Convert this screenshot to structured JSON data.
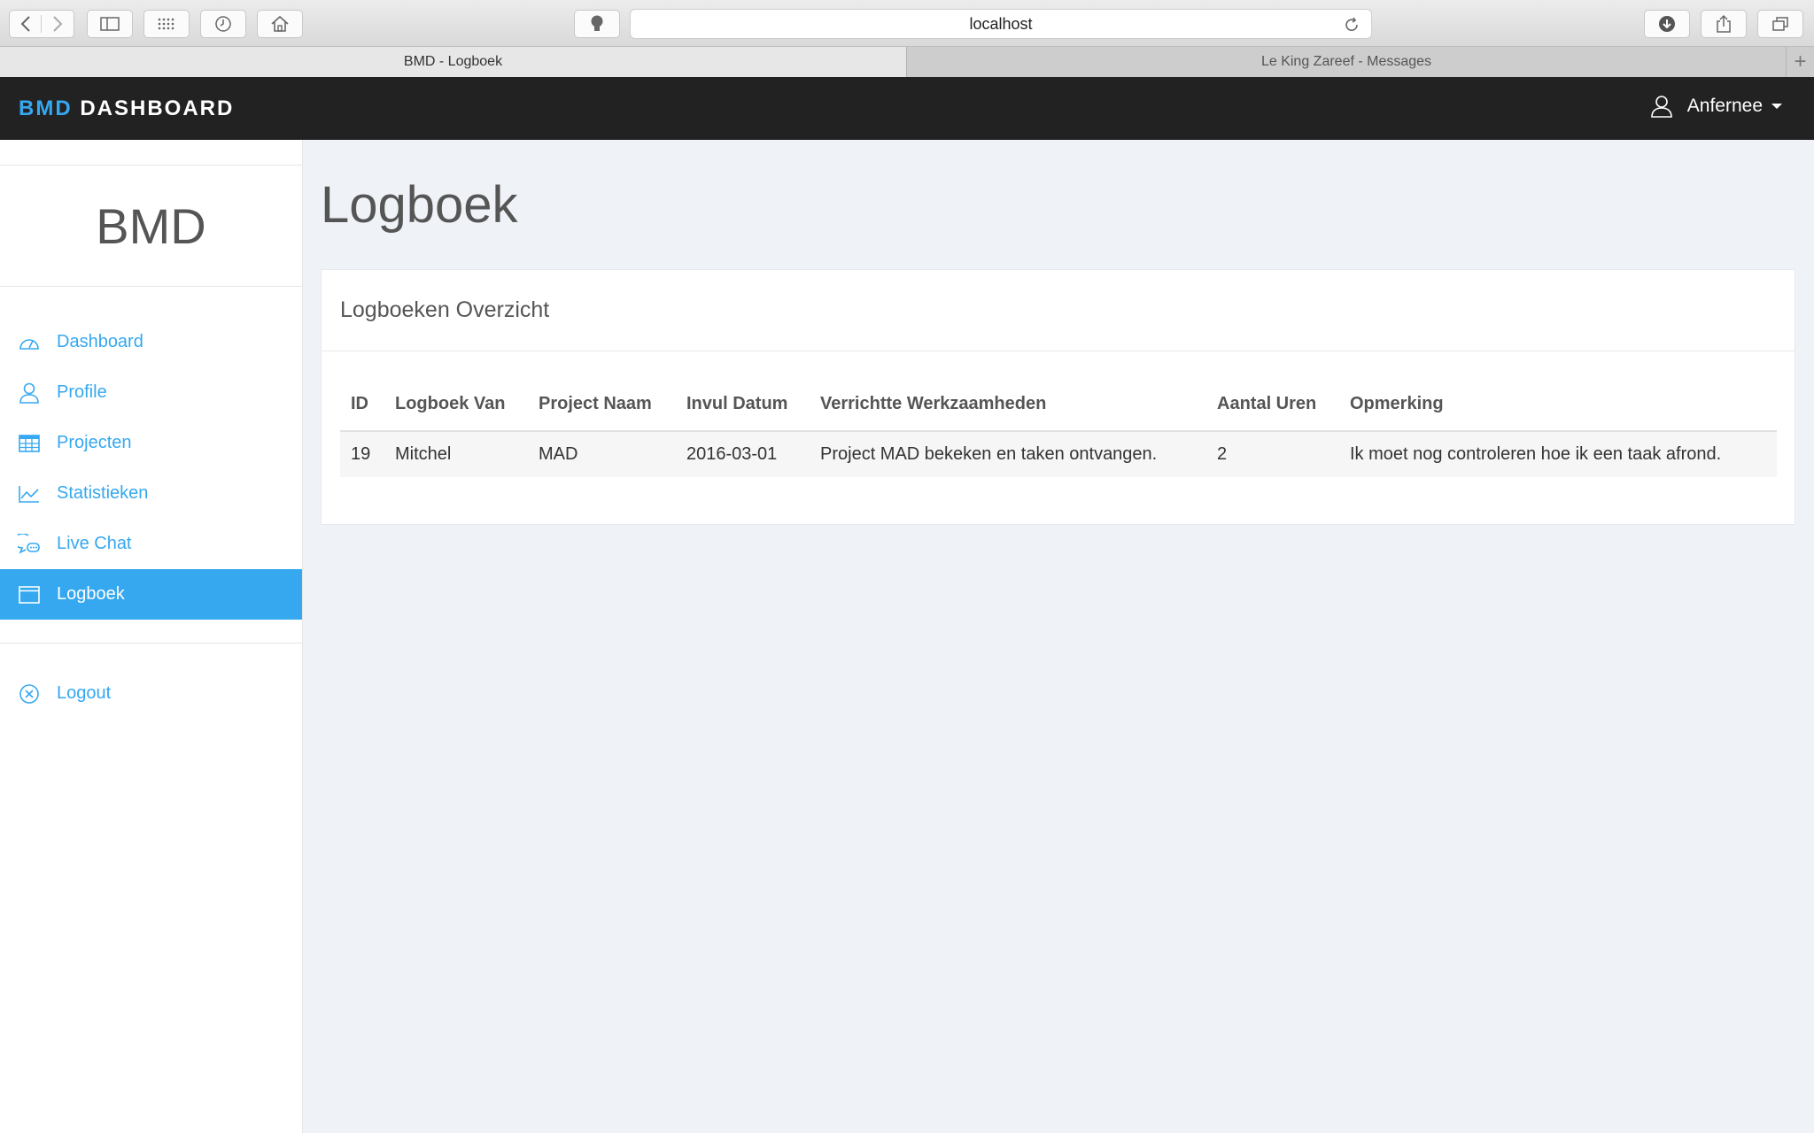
{
  "browser": {
    "url": "localhost",
    "tabs": [
      {
        "label": "BMD - Logboek",
        "active": true
      },
      {
        "label": "Le King Zareef - Messages",
        "active": false
      }
    ],
    "new_tab_label": "+"
  },
  "header": {
    "brand_accent": "BMD",
    "brand_rest": "DASHBOARD",
    "user_name": "Anfernee"
  },
  "sidebar": {
    "logo": "BMD",
    "items": [
      {
        "label": "Dashboard",
        "icon": "dashboard-gauge-icon"
      },
      {
        "label": "Profile",
        "icon": "user-icon"
      },
      {
        "label": "Projecten",
        "icon": "table-grid-icon"
      },
      {
        "label": "Statistieken",
        "icon": "line-chart-icon"
      },
      {
        "label": "Live Chat",
        "icon": "chat-bubbles-icon"
      },
      {
        "label": "Logboek",
        "icon": "window-icon",
        "active": true
      }
    ],
    "logout_label": "Logout"
  },
  "main": {
    "title": "Logboek",
    "panel_title": "Logboeken Overzicht",
    "table": {
      "headers": [
        "ID",
        "Logboek Van",
        "Project Naam",
        "Invul Datum",
        "Verrichtte Werkzaamheden",
        "Aantal Uren",
        "Opmerking"
      ],
      "rows": [
        [
          "19",
          "Mitchel",
          "MAD",
          "2016-03-01",
          "Project MAD bekeken en taken ontvangen.",
          "2",
          "Ik moet nog controleren hoe ik een taak afrond."
        ]
      ]
    }
  },
  "colors": {
    "accent": "#35a8f0",
    "header_bg": "#222222",
    "page_bg": "#eff2f7"
  }
}
